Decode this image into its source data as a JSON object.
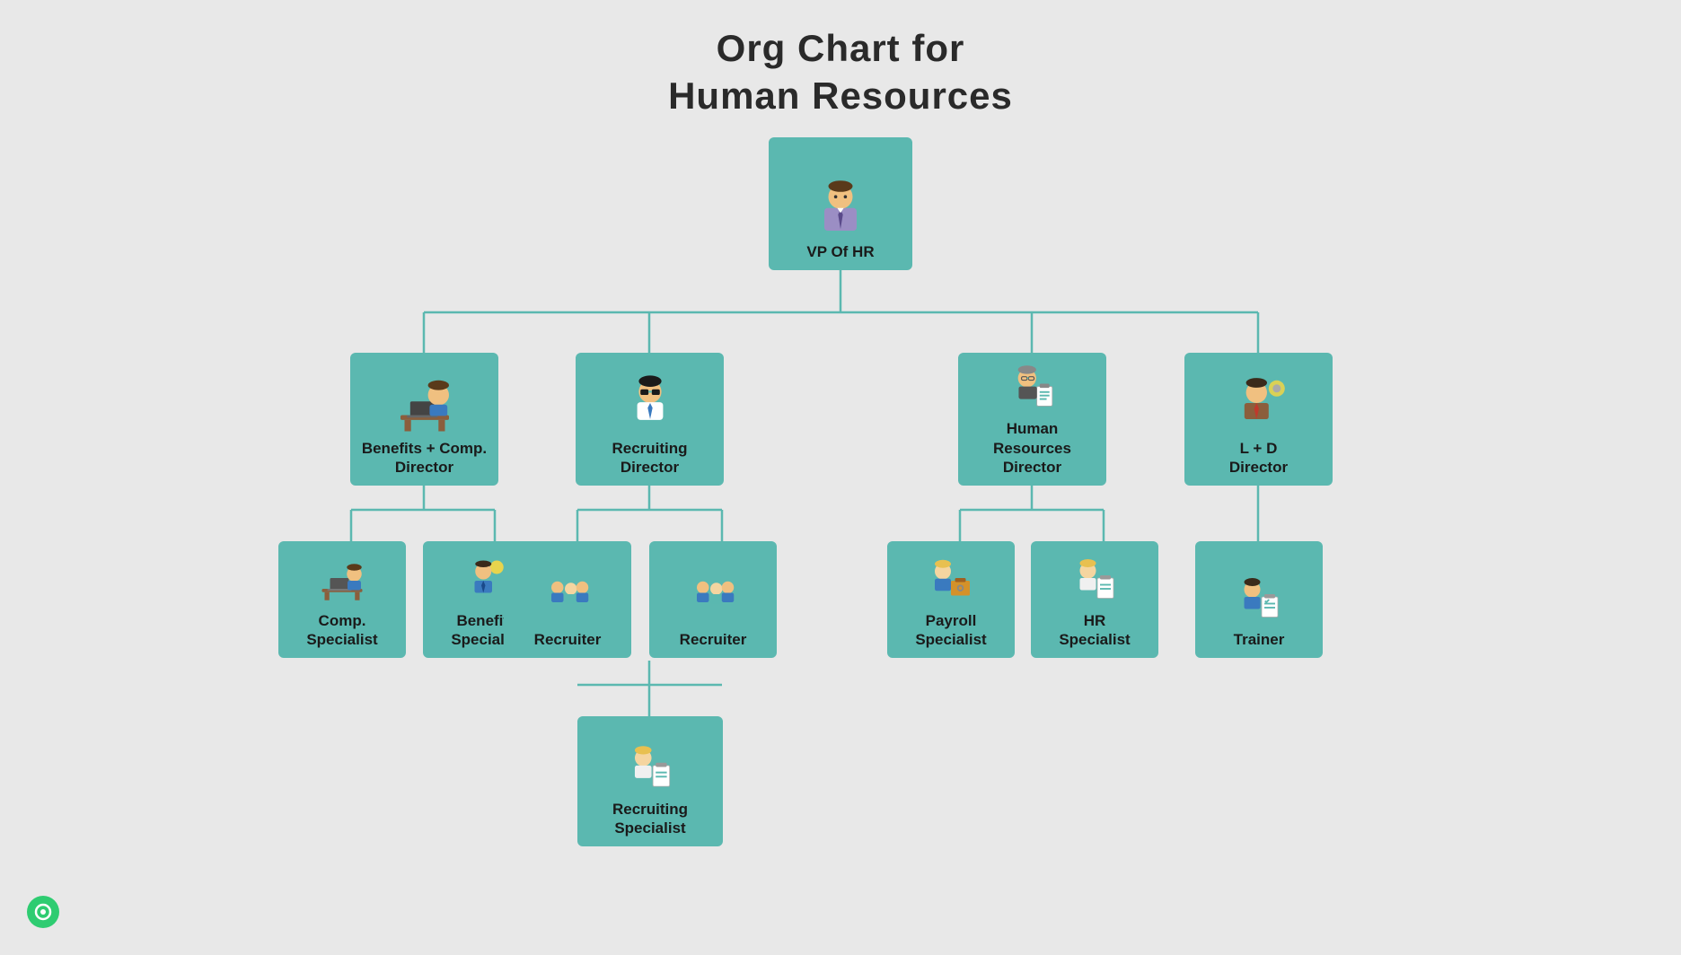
{
  "title": {
    "line1": "Org Chart for",
    "line2": "Human Resources"
  },
  "nodes": {
    "vp": {
      "label": "VP Of HR"
    },
    "directors": [
      {
        "id": "benefits-comp",
        "label": "Benefits + Comp. Director"
      },
      {
        "id": "recruiting",
        "label": "Recruiting Director"
      },
      {
        "id": "hr-director",
        "label": "Human Resources Director"
      },
      {
        "id": "ld-director",
        "label": "L + D Director"
      }
    ],
    "specialists": {
      "benefits-comp": [
        {
          "id": "comp-specialist",
          "label": "Comp. Specialist"
        },
        {
          "id": "benefits-specialist",
          "label": "Benefits Specialist"
        }
      ],
      "recruiting": [
        {
          "id": "recruiter1",
          "label": "Recruiter"
        },
        {
          "id": "recruiter2",
          "label": "Recruiter"
        }
      ],
      "hr-director": [
        {
          "id": "payroll-specialist",
          "label": "Payroll Specialist"
        },
        {
          "id": "hr-specialist",
          "label": "HR Specialist"
        }
      ],
      "ld-director": [
        {
          "id": "trainer",
          "label": "Trainer"
        }
      ]
    },
    "sub_specialists": {
      "recruiting": [
        {
          "id": "recruiting-specialist",
          "label": "Recruiting Specialist"
        }
      ]
    }
  },
  "colors": {
    "node_bg": "#5bb8b0",
    "connector": "#5bb8b0",
    "background": "#e8e8e8",
    "text": "#1a1a1a",
    "title": "#2a2a2a"
  },
  "logo": {
    "color": "#2ecc71"
  }
}
